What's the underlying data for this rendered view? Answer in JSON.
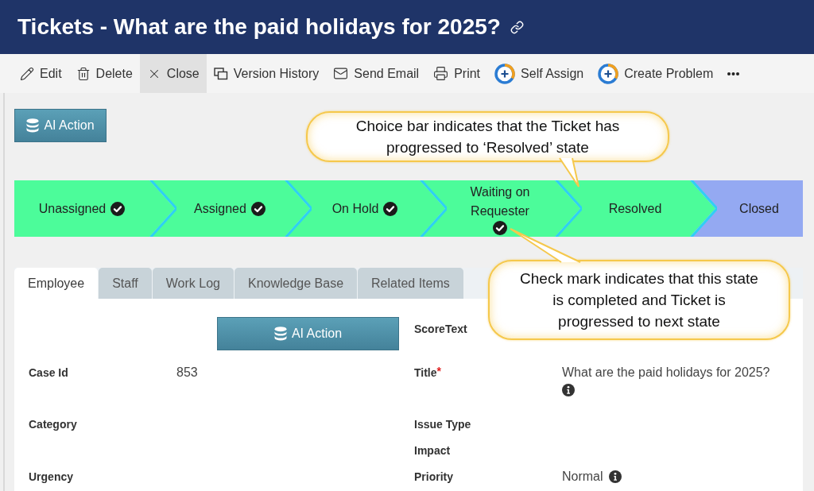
{
  "header": {
    "title": "Tickets - What are the paid holidays for 2025?"
  },
  "toolbar": [
    {
      "label": "Edit",
      "highlighted": false
    },
    {
      "label": "Delete",
      "highlighted": false
    },
    {
      "label": "Close",
      "highlighted": true
    },
    {
      "label": "Version History",
      "highlighted": false
    },
    {
      "label": "Send Email",
      "highlighted": false
    },
    {
      "label": "Print",
      "highlighted": false
    },
    {
      "label": "Self Assign",
      "highlighted": false
    },
    {
      "label": "Create Problem",
      "highlighted": false
    }
  ],
  "ai_action_button": {
    "label": "AI Action"
  },
  "stages": [
    {
      "label": "Unassigned",
      "reached": true,
      "completed": true
    },
    {
      "label": "Assigned",
      "reached": true,
      "completed": true
    },
    {
      "label": "On Hold",
      "reached": true,
      "completed": true
    },
    {
      "label": "Waiting on Requester",
      "reached": true,
      "completed": true
    },
    {
      "label": "Resolved",
      "reached": true,
      "completed": false
    },
    {
      "label": "Closed",
      "reached": false,
      "completed": false
    }
  ],
  "callouts": [
    {
      "text": "Choice bar indicates that the Ticket has progressed to ‘Resolved’ state"
    },
    {
      "text": "Check mark indicates that this state is completed and Ticket is progressed to next state"
    }
  ],
  "tabs": [
    {
      "label": "Employee",
      "selected": true
    },
    {
      "label": "Staff",
      "selected": false
    },
    {
      "label": "Work Log",
      "selected": false
    },
    {
      "label": "Knowledge Base",
      "selected": false
    },
    {
      "label": "Related Items",
      "selected": false
    }
  ],
  "form": {
    "rows": [
      {
        "left": [
          {
            "kind": "action",
            "label": "AI Action"
          }
        ],
        "right": [
          {
            "kind": "field",
            "label": "ScoreText"
          }
        ]
      },
      {
        "left": [
          {
            "kind": "field",
            "label": "Case Id",
            "value": "853"
          }
        ],
        "right": [
          {
            "kind": "field",
            "label": "Title",
            "required_mark": "*",
            "value": "What are the paid holidays for 2025?",
            "info": true
          }
        ]
      },
      {
        "left": [
          {
            "kind": "field",
            "label": "Category"
          }
        ],
        "right": [
          {
            "kind": "field",
            "label": "Issue Type"
          },
          {
            "kind": "field",
            "label": "Impact"
          }
        ]
      },
      {
        "left": [
          {
            "kind": "field",
            "label": "Urgency"
          }
        ],
        "right": [
          {
            "kind": "field",
            "label": "Priority",
            "value": "Normal",
            "info": true
          }
        ]
      }
    ]
  }
}
